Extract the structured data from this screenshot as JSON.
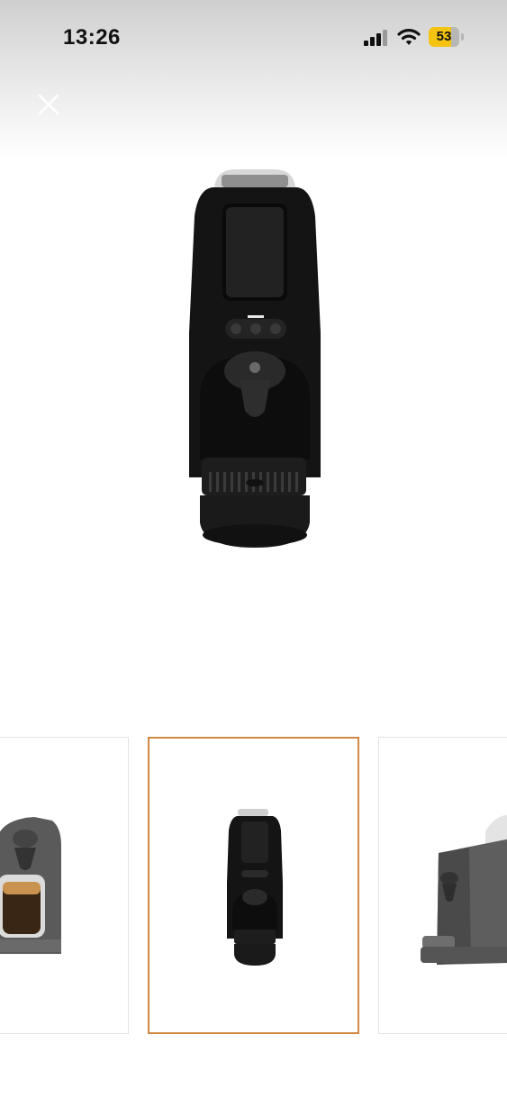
{
  "status_bar": {
    "time": "13:26",
    "battery_level": "53",
    "icons": [
      "cellular-signal-icon",
      "wifi-icon",
      "battery-icon"
    ]
  },
  "header": {
    "close_icon": "close-icon"
  },
  "gallery": {
    "selected_index": 1,
    "thumbnails": [
      {
        "name": "thumbnail-coffee-machine-with-cup",
        "selected": false
      },
      {
        "name": "thumbnail-coffee-machine-front",
        "selected": true
      },
      {
        "name": "thumbnail-coffee-machine-side",
        "selected": false
      }
    ]
  },
  "colors": {
    "selection_border": "#d08a45",
    "battery_fill": "#f4c30f",
    "machine_body": "#141414"
  }
}
